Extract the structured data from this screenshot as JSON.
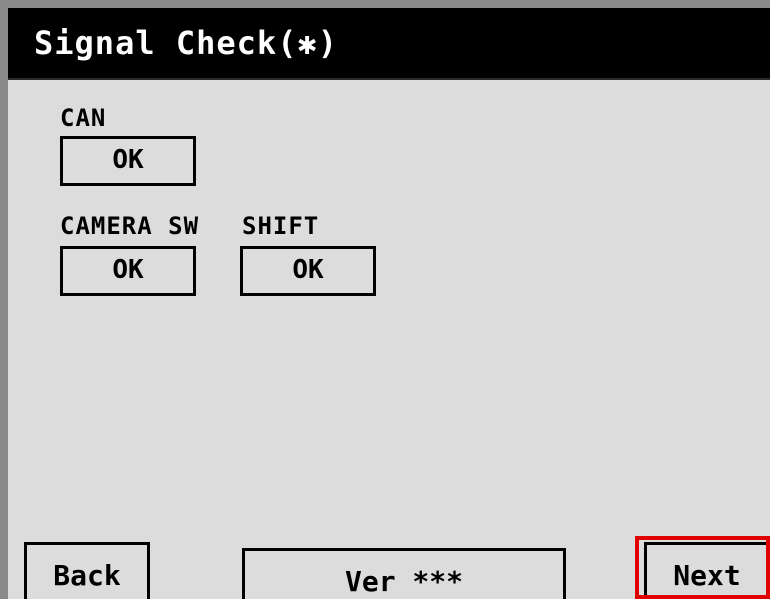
{
  "header": {
    "title": "Signal Check(✱)"
  },
  "signals": {
    "can": {
      "label": "CAN",
      "value": "OK"
    },
    "camera_sw": {
      "label": "CAMERA SW",
      "value": "OK"
    },
    "shift": {
      "label": "SHIFT",
      "value": "OK"
    }
  },
  "footer": {
    "back_label": "Back",
    "version_label": "Ver ***",
    "next_label": "Next"
  },
  "colors": {
    "screen_bg": "#dcdcdc",
    "titlebar_bg": "#000000",
    "highlight": "#e00000"
  }
}
